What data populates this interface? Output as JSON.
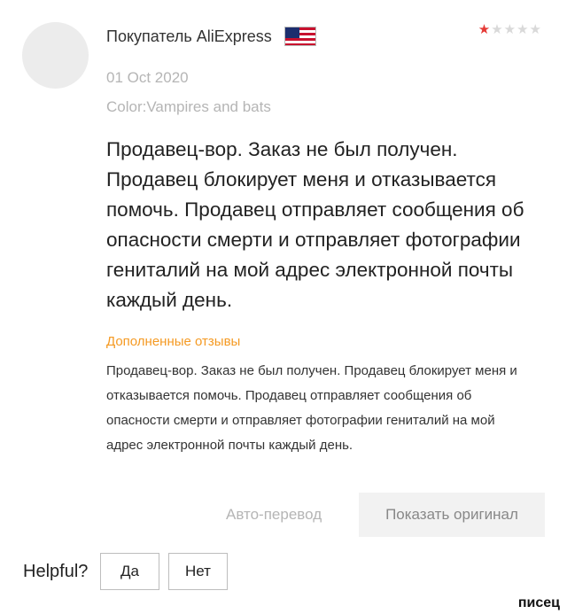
{
  "review": {
    "reviewer_name": "Покупатель AliExpress",
    "country_flag": "us-flag-icon",
    "rating": 1,
    "rating_max": 5,
    "date": "01 Oct 2020",
    "color_option": "Color:Vampires and bats",
    "text": "Продавец-вор. Заказ не был получен. Продавец блокирует меня и отказывается помочь. Продавец отправляет сообщения об опасности смерти и отправляет фотографии гениталий на мой адрес электронной почты каждый день."
  },
  "additional": {
    "title": "Дополненные отзывы",
    "text": "Продавец-вор. Заказ не был получен. Продавец блокирует меня и отказывается помочь. Продавец отправляет сообщения об опасности смерти и отправляет фотографии гениталий на мой адрес электронной почты каждый день."
  },
  "actions": {
    "auto_translate": "Авто-перевод",
    "show_original": "Показать оригинал"
  },
  "helpful": {
    "label": "Helpful?",
    "yes": "Да",
    "no": "Нет"
  },
  "watermark": "писец",
  "colors": {
    "star_active": "#e53935",
    "star_inactive": "#d9d9d9",
    "accent_orange": "#f59a23",
    "muted_text": "#b5b5b5"
  }
}
